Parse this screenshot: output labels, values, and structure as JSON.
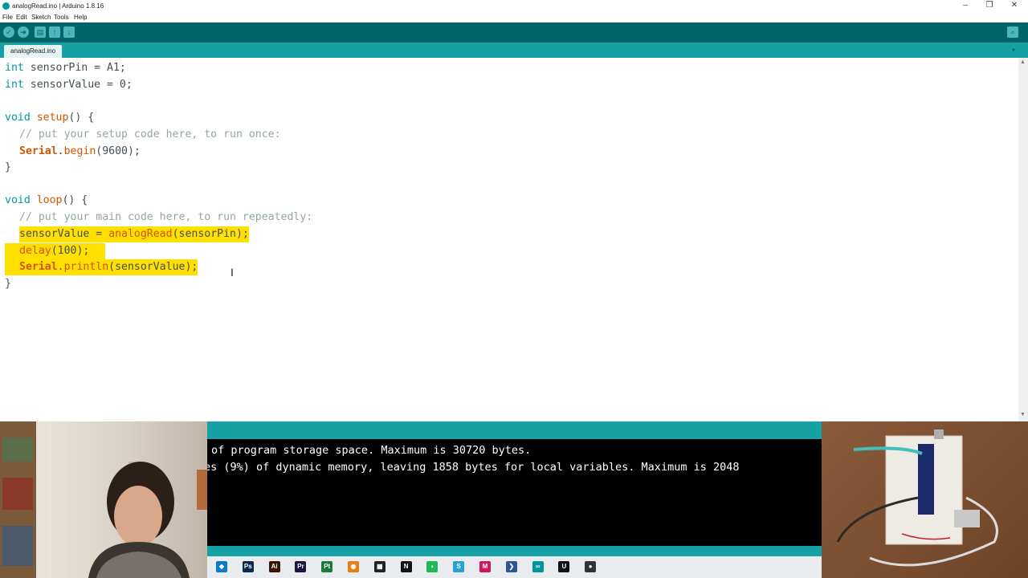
{
  "window": {
    "title": "analogRead.ino | Arduino 1.8.16",
    "minimize": "–",
    "restore": "❐",
    "close": "✕"
  },
  "menu": [
    "File",
    "Edit",
    "Sketch",
    "Tools",
    "Help"
  ],
  "toolbar": {
    "verify_icon": "✓",
    "upload_icon": "➜",
    "new_icon": "▤",
    "open_icon": "↑",
    "save_icon": "↓",
    "serial_monitor_icon": "⌕"
  },
  "tab": {
    "label": "analogRead.ino",
    "menu_icon": "▾"
  },
  "code": {
    "line1": {
      "type": "int",
      "rest": " sensorPin = A1;"
    },
    "line2": {
      "type": "int",
      "rest": " sensorValue = 0;"
    },
    "line4": {
      "kw": "void",
      "fn": "setup",
      "rest": "() {"
    },
    "line5": "// put your setup code here, to run once:",
    "line6": {
      "cls": "Serial",
      "dot": ".",
      "fn": "begin",
      "rest": "(9600);"
    },
    "line7": "}",
    "line9": {
      "kw": "void",
      "fn": "loop",
      "rest": "() {"
    },
    "line10": "// put your main code here, to run repeatedly:",
    "line11": {
      "var": "sensorValue = ",
      "fn": "analogRead",
      "rest": "(sensorPin);"
    },
    "line12": {
      "fn": "delay",
      "rest": "(100);"
    },
    "line13": {
      "cls": "Serial",
      "dot": ".",
      "fn": "println",
      "rest": "(sensorValue);"
    },
    "line14": "}"
  },
  "cursor": "I",
  "console": {
    "line1": "of program storage space. Maximum is 30720 bytes.",
    "line2": "es (9%) of dynamic memory, leaving 1858 bytes for local variables. Maximum is 2048"
  },
  "taskbar_icons": [
    {
      "name": "vscode-icon",
      "glyph": "◆",
      "color": "#0a7acc"
    },
    {
      "name": "photoshop-icon",
      "glyph": "Ps",
      "color": "#0b2a4a"
    },
    {
      "name": "illustrator-icon",
      "glyph": "Ai",
      "color": "#3a1400"
    },
    {
      "name": "premiere-icon",
      "glyph": "Pr",
      "color": "#1d1440"
    },
    {
      "name": "pycharm-icon",
      "glyph": "Pt",
      "color": "#1c7a3c"
    },
    {
      "name": "blender-icon",
      "glyph": "◉",
      "color": "#e87d0d"
    },
    {
      "name": "film-icon",
      "glyph": "▦",
      "color": "#222222"
    },
    {
      "name": "notion-icon",
      "glyph": "N",
      "color": "#111111"
    },
    {
      "name": "spotify-icon",
      "glyph": "◗",
      "color": "#1db954"
    },
    {
      "name": "app-s-icon",
      "glyph": "S",
      "color": "#2aa0d8"
    },
    {
      "name": "app-m-icon",
      "glyph": "M",
      "color": "#d4145a"
    },
    {
      "name": "powershell-icon",
      "glyph": "❯",
      "color": "#2f5597"
    },
    {
      "name": "arduino-icon",
      "glyph": "∞",
      "color": "#00979c"
    },
    {
      "name": "unreal-icon",
      "glyph": "U",
      "color": "#111111"
    },
    {
      "name": "obs-icon",
      "glyph": "●",
      "color": "#333333"
    }
  ]
}
